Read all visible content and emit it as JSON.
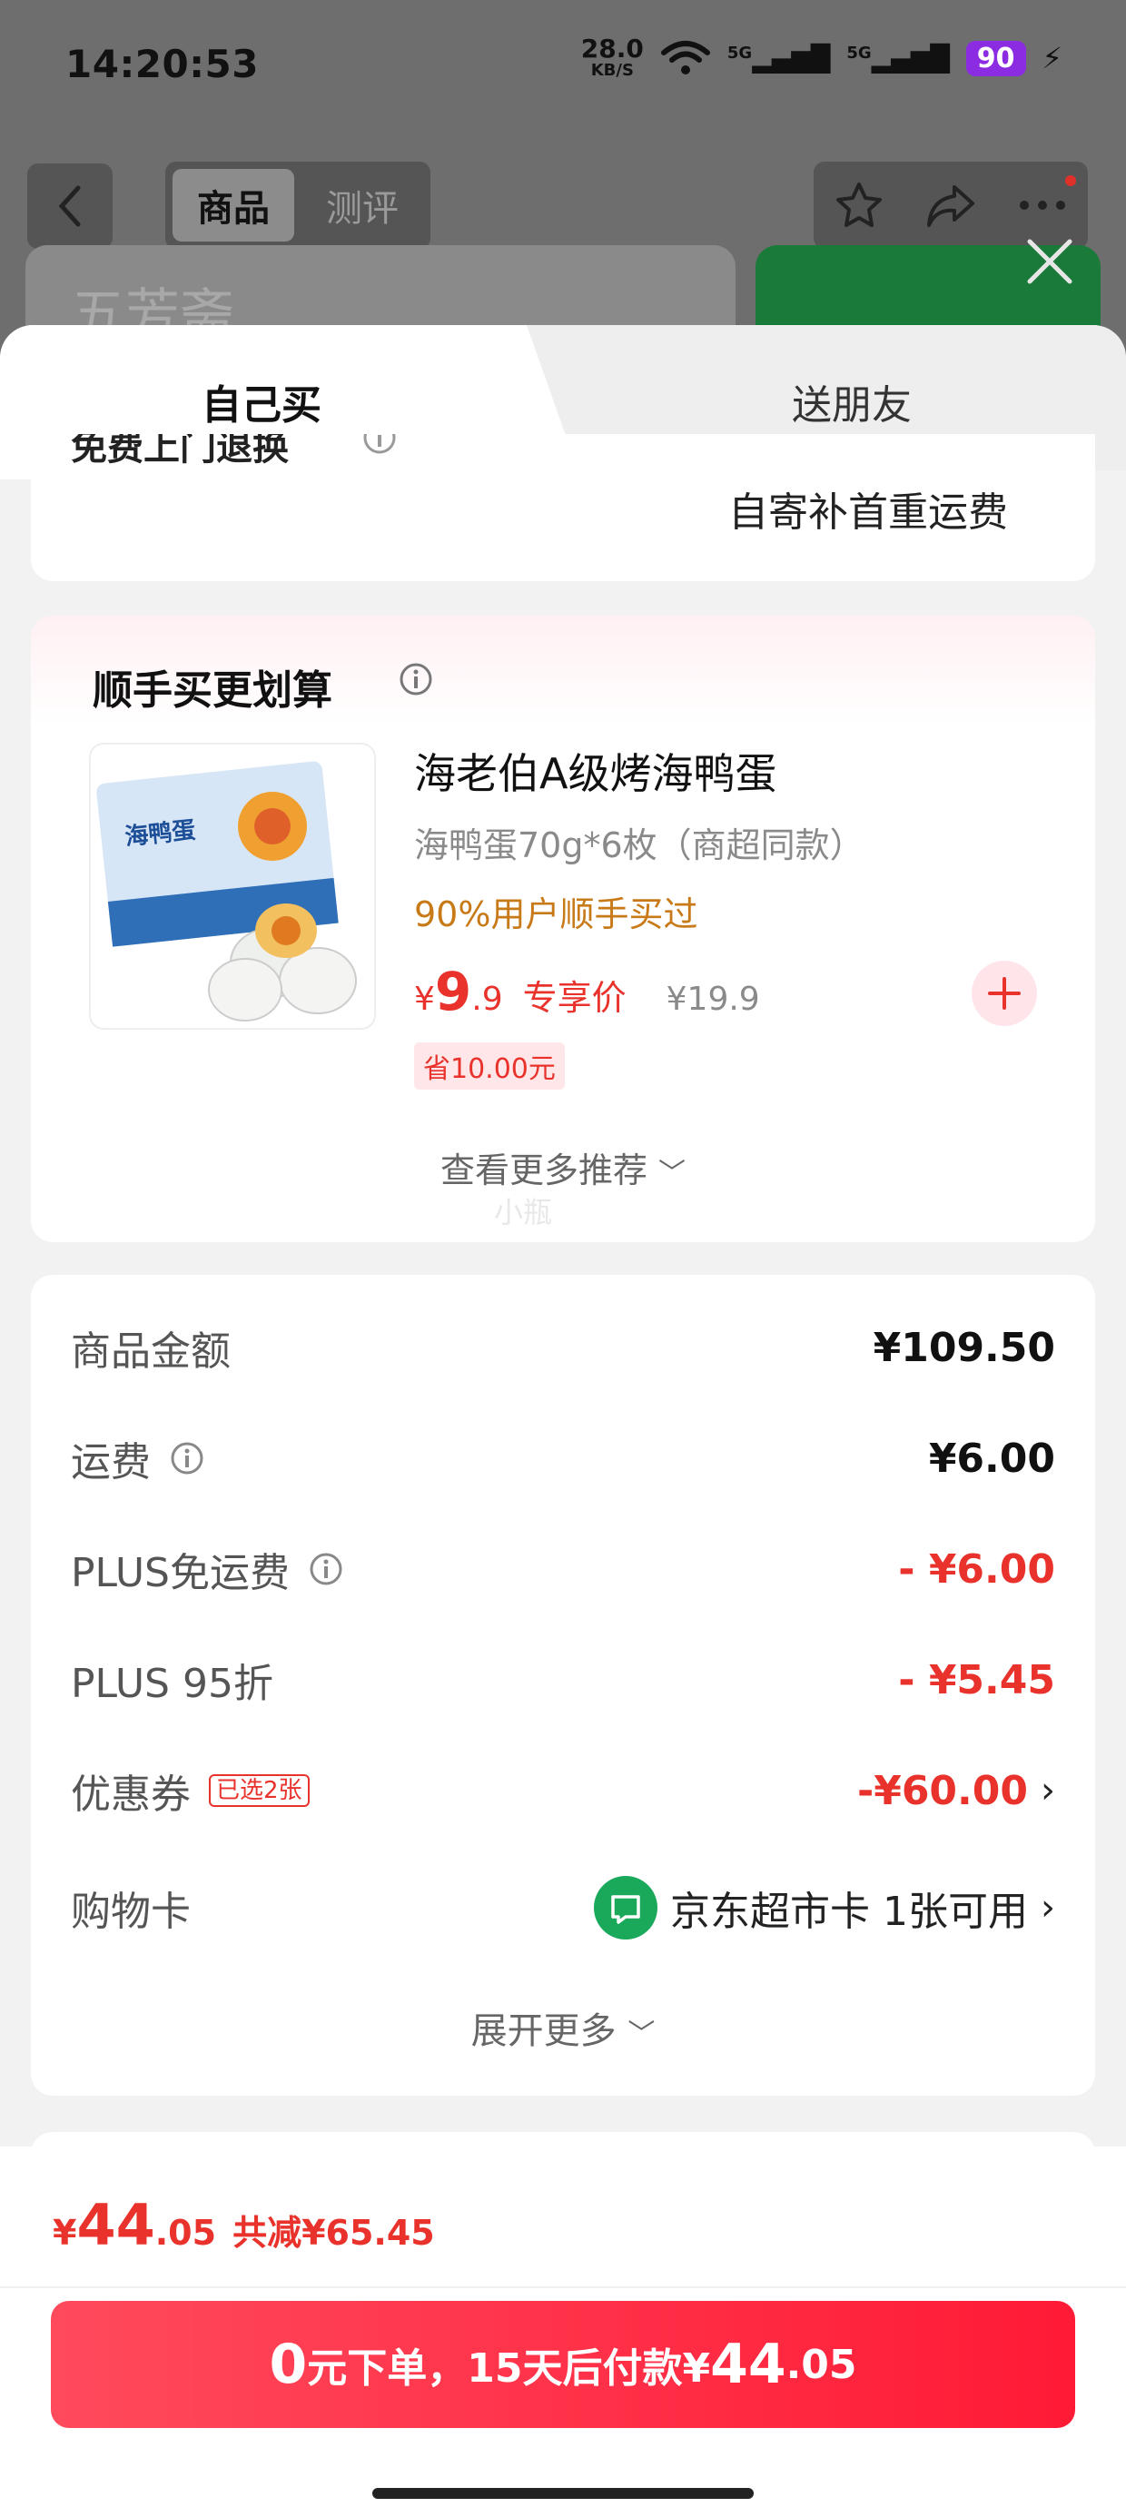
{
  "status_bar": {
    "time": "14:20:53",
    "net_speed_value": "28.0",
    "net_speed_unit": "KB/S",
    "signal_1": "5G",
    "signal_2": "5G",
    "battery": "90"
  },
  "header": {
    "tabs": [
      "商品",
      "测评"
    ],
    "active_tab": "商品",
    "brand_watermark": "五芳斋"
  },
  "sheet_tabs": {
    "self": "自己买",
    "gift": "送朋友"
  },
  "shipping_card": {
    "partial_label": "免费上门退换",
    "right_text": "自寄补首重运费"
  },
  "recommend": {
    "title": "顺手买更划算",
    "product": {
      "name": "海老伯A级烤海鸭蛋",
      "spec": "海鸭蛋70g*6枚（商超同款）",
      "social_proof": "90%用户顺手买过",
      "price_yen": "¥",
      "price_int": "9",
      "price_dec": ".9",
      "price_tag": "专享价",
      "original_price": "¥19.9",
      "save_text": "省10.00元",
      "image_label": "海鸭蛋"
    },
    "more_label": "查看更多推荐",
    "watermark": "小瓶"
  },
  "summary": {
    "rows": [
      {
        "label": "商品金额",
        "value": "¥109.50"
      },
      {
        "label": "运费",
        "value": "¥6.00"
      },
      {
        "label": "PLUS免运费",
        "value": "- ¥6.00"
      },
      {
        "label": "PLUS 95折",
        "value": "- ¥5.45"
      },
      {
        "label": "优惠券",
        "tag": "已选2张",
        "value": "-¥60.00"
      },
      {
        "label": "购物卡",
        "card_name": "京东超市卡",
        "value": "1张可用"
      }
    ],
    "expand_label": "展开更多"
  },
  "bottom_bar": {
    "total_yen": "¥",
    "total_int": "44",
    "total_dec": ".05",
    "total_saved": "共减¥65.45",
    "pay_zero": "0",
    "pay_text": "元下单，15天后付款¥",
    "pay_int": "44",
    "pay_dec": ".05"
  },
  "colors": {
    "accent_red": "#e8322b",
    "social_orange": "#c87a18",
    "jd_green": "#1aa85a",
    "button_gradient_start": "#ff4a5c",
    "button_gradient_end": "#ff1a36"
  }
}
